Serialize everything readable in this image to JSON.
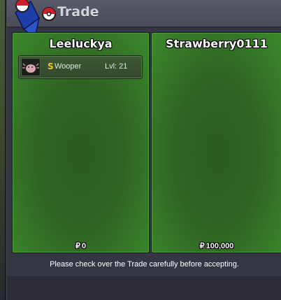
{
  "window": {
    "title": "Trade"
  },
  "trade": {
    "left": {
      "name": "Leeluckya",
      "currency_symbol": "₽",
      "money": "0",
      "pokemon": [
        {
          "shiny_mark": "S",
          "name": "Wooper",
          "level": "Lvl: 21",
          "icon": "wooper-sprite-icon"
        }
      ]
    },
    "right": {
      "name": "Strawberry0111",
      "currency_symbol": "₽",
      "money": "100,000",
      "pokemon": []
    }
  },
  "notice": "Please check over the Trade carefully before accepting.",
  "colors": {
    "panel_green": "#2f6423",
    "panel_edge": "#4fa33a",
    "window_bg": "#343644",
    "titlebar": "#4a4c58",
    "shiny_gold": "#f2c81b"
  }
}
